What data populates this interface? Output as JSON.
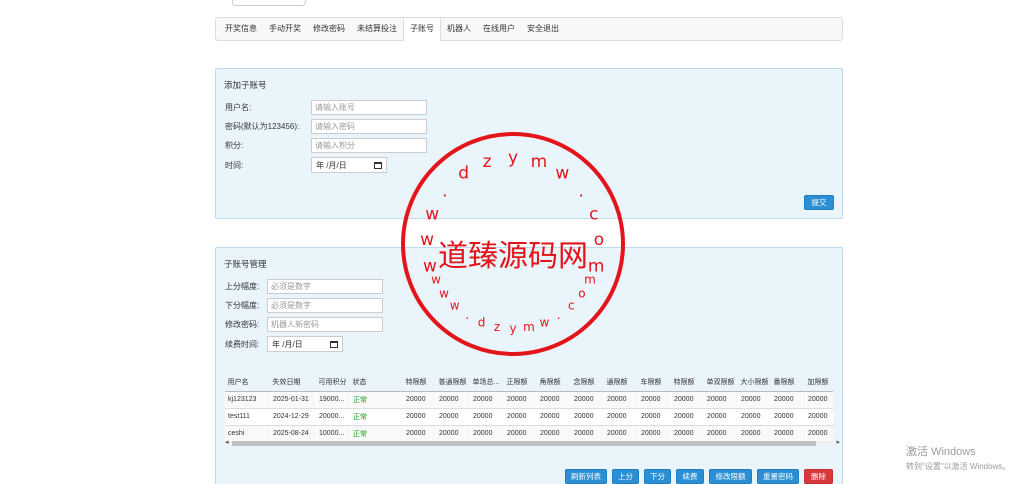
{
  "nav": {
    "items": [
      {
        "label": "开奖信息"
      },
      {
        "label": "手动开奖"
      },
      {
        "label": "修改密码"
      },
      {
        "label": "未结算投注"
      },
      {
        "label": "子账号"
      },
      {
        "label": "机器人"
      },
      {
        "label": "在线用户"
      },
      {
        "label": "安全退出"
      }
    ],
    "active": "子账号"
  },
  "add_panel": {
    "title": "添加子账号",
    "username_label": "用户名:",
    "username_placeholder": "请输入账号",
    "password_label": "密码(默认为123456):",
    "password_placeholder": "请输入密码",
    "points_label": "积分:",
    "points_placeholder": "请输入积分",
    "time_label": "时间:",
    "date_placeholder": "年 /月/日",
    "submit_label": "提交"
  },
  "manage_panel": {
    "title": "子账号管理",
    "up_label": "上分幅度:",
    "up_placeholder": "必须是数字",
    "down_label": "下分幅度:",
    "down_placeholder": "必须是数字",
    "robot_pw_label": "修改密码:",
    "robot_pw_placeholder": "机器人新密码",
    "renew_label": "续费时间:",
    "date_placeholder": "年 /月/日",
    "table": {
      "headers": [
        "用户名",
        "失效日期",
        "可用积分",
        "状态",
        "特限额",
        "普通限额",
        "单场总...",
        "正限额",
        "角限额",
        "念限额",
        "通限额",
        "车限额",
        "特限额",
        "单双限额",
        "大小限额",
        "番限额",
        "加限额"
      ],
      "rows": [
        [
          "kj123123",
          "2025-01-31",
          "19000...",
          "正常",
          "20000",
          "20000",
          "20000",
          "20000",
          "20000",
          "20000",
          "20000",
          "20000",
          "20000",
          "20000",
          "20000",
          "20000",
          "20000"
        ],
        [
          "test111",
          "2024-12-29",
          "20000...",
          "正常",
          "20000",
          "20000",
          "20000",
          "20000",
          "20000",
          "20000",
          "20000",
          "20000",
          "20000",
          "20000",
          "20000",
          "20000",
          "20000"
        ],
        [
          "ceshi",
          "2025-08-24",
          "10000...",
          "正常",
          "20000",
          "20000",
          "20000",
          "20000",
          "20000",
          "20000",
          "20000",
          "20000",
          "20000",
          "20000",
          "20000",
          "20000",
          "20000"
        ]
      ]
    },
    "buttons": {
      "refresh": "刷新列表",
      "up": "上分",
      "down": "下分",
      "renew": "续费",
      "edit_limit": "修改限额",
      "reset_pw": "重置密码",
      "delete": "删除"
    }
  },
  "stamp": {
    "center_text": "道臻源码网",
    "ring_text": "www.dzymw.com",
    "color": "#e3151a"
  },
  "os_watermark": {
    "line1": "激活 Windows",
    "line2": "转到\"设置\"以激活 Windows。"
  }
}
